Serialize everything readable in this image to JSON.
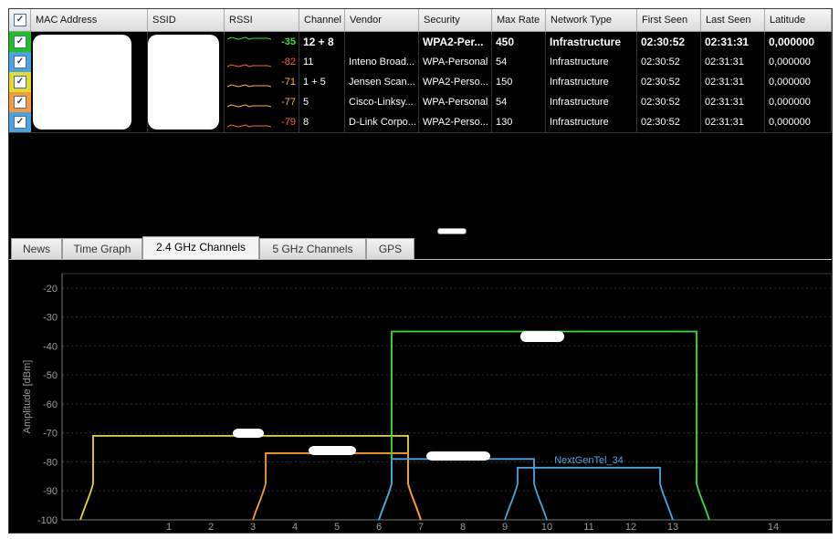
{
  "table": {
    "headers": [
      "MAC Address",
      "SSID",
      "RSSI",
      "Channel",
      "Vendor",
      "Security",
      "Max Rate",
      "Network Type",
      "First Seen",
      "Last Seen",
      "Latitude"
    ],
    "rows": [
      {
        "color": "#21c021",
        "rssi": "-35",
        "rssi_color": "#39e239",
        "channel": "12 + 8",
        "vendor": "",
        "security": "WPA2-Per...",
        "max_rate": "450",
        "network_type": "Infrastructure",
        "first_seen": "02:30:52",
        "last_seen": "02:31:31",
        "latitude": "0,000000",
        "bold": true
      },
      {
        "color": "#4aa3df",
        "rssi": "-82",
        "rssi_color": "#ff6040",
        "channel": "11",
        "vendor": "Inteno Broad...",
        "security": "WPA-Personal",
        "max_rate": "54",
        "network_type": "Infrastructure",
        "first_seen": "02:30:52",
        "last_seen": "02:31:31",
        "latitude": "0,000000",
        "bold": false
      },
      {
        "color": "#e6d92e",
        "rssi": "-71",
        "rssi_color": "#ffb030",
        "channel": "1 + 5",
        "vendor": "Jensen Scan...",
        "security": "WPA2-Perso...",
        "max_rate": "150",
        "network_type": "Infrastructure",
        "first_seen": "02:30:52",
        "last_seen": "02:31:31",
        "latitude": "0,000000",
        "bold": false
      },
      {
        "color": "#f59a35",
        "rssi": "-77",
        "rssi_color": "#ffb030",
        "channel": "5",
        "vendor": "Cisco-Linksy...",
        "security": "WPA-Personal",
        "max_rate": "54",
        "network_type": "Infrastructure",
        "first_seen": "02:30:52",
        "last_seen": "02:31:31",
        "latitude": "0,000000",
        "bold": false
      },
      {
        "color": "#4aa3df",
        "rssi": "-79",
        "rssi_color": "#ff6040",
        "channel": "8",
        "vendor": "D-Link Corpo...",
        "security": "WPA2-Perso...",
        "max_rate": "130",
        "network_type": "Infrastructure",
        "first_seen": "02:30:52",
        "last_seen": "02:31:31",
        "latitude": "0,000000",
        "bold": false
      }
    ]
  },
  "tabs": [
    {
      "label": "News",
      "active": false
    },
    {
      "label": "Time Graph",
      "active": false
    },
    {
      "label": "2.4 GHz Channels",
      "active": true
    },
    {
      "label": "5 GHz Channels",
      "active": false
    },
    {
      "label": "GPS",
      "active": false
    }
  ],
  "chart_data": {
    "type": "line",
    "ylabel": "Amplitude [dBm]",
    "ylim": [
      -100,
      -15
    ],
    "y_ticks": [
      -20,
      -30,
      -40,
      -50,
      -60,
      -70,
      -80,
      -90,
      -100
    ],
    "x_ticks": [
      {
        "label": "1",
        "channel": 1
      },
      {
        "label": "2",
        "channel": 2
      },
      {
        "label": "3",
        "channel": 3
      },
      {
        "label": "4",
        "channel": 4
      },
      {
        "label": "5",
        "channel": 5
      },
      {
        "label": "6",
        "channel": 6
      },
      {
        "label": "7",
        "channel": 7
      },
      {
        "label": "8",
        "channel": 8
      },
      {
        "label": "9",
        "channel": 9
      },
      {
        "label": "10",
        "channel": 10
      },
      {
        "label": "11",
        "channel": 11
      },
      {
        "label": "12",
        "channel": 12
      },
      {
        "label": "13",
        "channel": 13
      },
      {
        "label": "14",
        "channel": 14
      }
    ],
    "grid": true,
    "series": [
      {
        "color": "#e6d92e",
        "start_channel": -1,
        "end_channel": 7,
        "amplitude": -71,
        "label": ""
      },
      {
        "color": "#f59a35",
        "start_channel": 3,
        "end_channel": 7,
        "amplitude": -77,
        "label": ""
      },
      {
        "color": "#3ddc3d",
        "start_channel": 6,
        "end_channel": 14,
        "amplitude": -35,
        "label": ""
      },
      {
        "color": "#4aa3df",
        "start_channel": 6,
        "end_channel": 10,
        "amplitude": -79,
        "label": ""
      },
      {
        "color": "#4aa3df",
        "start_channel": 9,
        "end_channel": 13,
        "amplitude": -82,
        "label": "NextGenTel_34"
      }
    ]
  }
}
